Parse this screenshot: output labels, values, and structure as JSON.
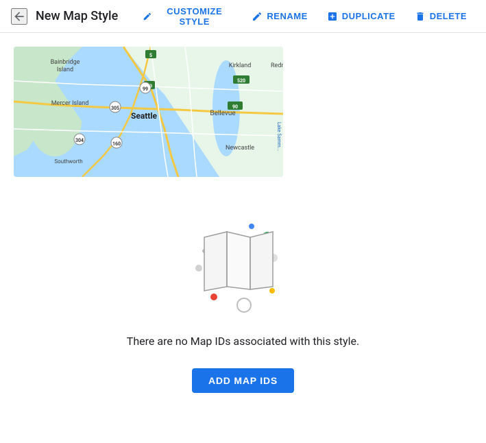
{
  "header": {
    "back_icon": "arrow-left-icon",
    "title": "New Map Style",
    "actions": [
      {
        "id": "customize",
        "label": "CUSTOMIZE STYLE",
        "icon": "pencil-icon"
      },
      {
        "id": "rename",
        "label": "RENAME",
        "icon": "edit-icon"
      },
      {
        "id": "duplicate",
        "label": "DUPLICATE",
        "icon": "copy-plus-icon"
      },
      {
        "id": "delete",
        "label": "DELETE",
        "icon": "trash-icon"
      }
    ]
  },
  "map_preview": {
    "alt": "Seattle area map preview"
  },
  "empty_state": {
    "message": "There are no Map IDs associated with this style.",
    "button_label": "ADD MAP IDS"
  }
}
